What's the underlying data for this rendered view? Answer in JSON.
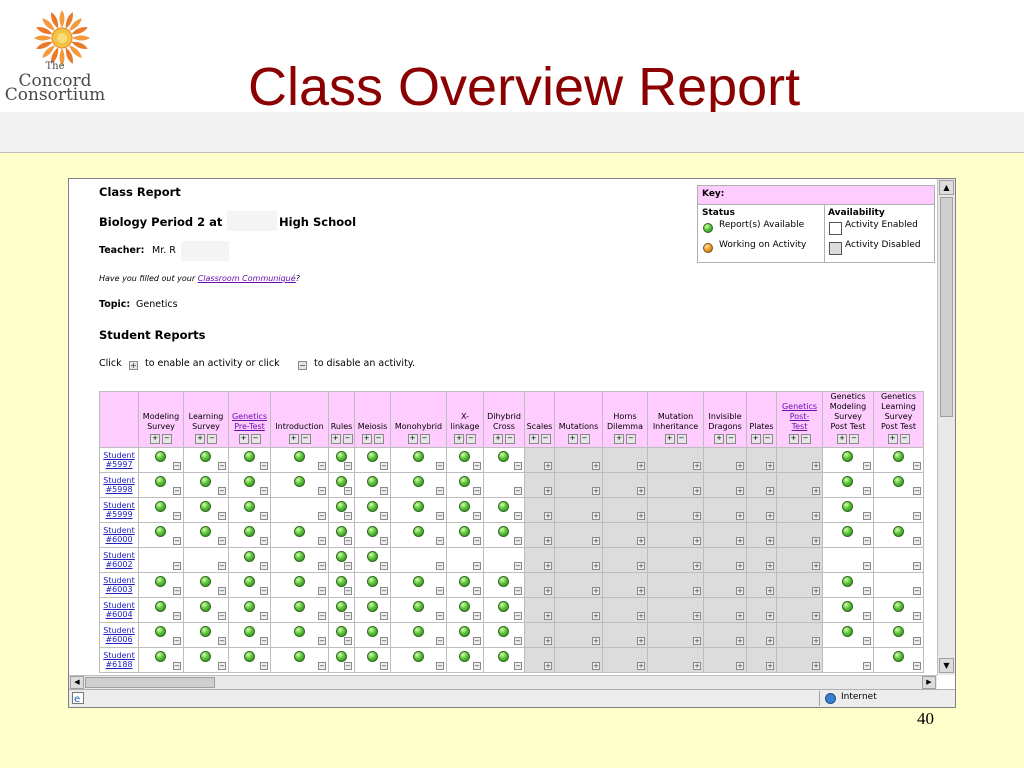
{
  "slide": {
    "title": "Class Overview Report",
    "page_number": "40",
    "logo": {
      "line1": "The",
      "line2": "Concord",
      "line3": "Consortium"
    }
  },
  "report": {
    "heading": "Class Report",
    "class_prefix": "Biology Period 2 at",
    "class_suffix": "High School",
    "teacher_label": "Teacher:",
    "teacher_value": "Mr. R",
    "communique_prefix": "Have you filled out your ",
    "communique_link": "Classroom Communiqué",
    "communique_suffix": "?",
    "topic_label": "Topic:",
    "topic_value": "Genetics",
    "student_reports": "Student Reports",
    "instruction_1": "Click",
    "instruction_2": "to enable an activity or click",
    "instruction_3": "to disable an activity."
  },
  "key": {
    "title": "Key:",
    "status_label": "Status",
    "availability_label": "Availability",
    "report_available": "Report(s) Available",
    "working": "Working on Activity",
    "enabled": "Activity Enabled",
    "disabled": "Activity Disabled"
  },
  "columns": [
    {
      "label": [
        "Modeling",
        "Survey"
      ],
      "link": false
    },
    {
      "label": [
        "Learning",
        "Survey"
      ],
      "link": false
    },
    {
      "label": [
        "Genetics",
        "Pre-Test"
      ],
      "link": true
    },
    {
      "label": [
        "Introduction"
      ],
      "link": false
    },
    {
      "label": [
        "Rules"
      ],
      "link": false
    },
    {
      "label": [
        "Meiosis"
      ],
      "link": false
    },
    {
      "label": [
        "Monohybrid"
      ],
      "link": false
    },
    {
      "label": [
        "X-",
        "linkage"
      ],
      "link": false
    },
    {
      "label": [
        "Dihybrid",
        "Cross"
      ],
      "link": false
    },
    {
      "label": [
        "Scales"
      ],
      "link": false
    },
    {
      "label": [
        "Mutations"
      ],
      "link": false
    },
    {
      "label": [
        "Horns",
        "Dilemma"
      ],
      "link": false
    },
    {
      "label": [
        "Mutation",
        "Inheritance"
      ],
      "link": false
    },
    {
      "label": [
        "Invisible",
        "Dragons"
      ],
      "link": false
    },
    {
      "label": [
        "Plates"
      ],
      "link": false
    },
    {
      "label": [
        "Genetics",
        "Post-",
        "Test"
      ],
      "link": true
    },
    {
      "label": [
        "Genetics",
        "Modeling",
        "Survey",
        "Post Test"
      ],
      "link": false
    },
    {
      "label": [
        "Genetics",
        "Learning",
        "Survey",
        "Post Test"
      ],
      "link": false
    }
  ],
  "rows": [
    {
      "student": [
        "Student",
        "#5997"
      ],
      "cells": "GGGGGGGGGdddddddGGG"
    },
    {
      "student": [
        "Student",
        "#5998"
      ],
      "cells": "GGGGGGGGedddddddGGG"
    },
    {
      "student": [
        "Student",
        "#5999"
      ],
      "cells": "GGGeGGGGGdddddddGee"
    },
    {
      "student": [
        "Student",
        "#6000"
      ],
      "cells": "GGGGGGGGGdddddddGGG"
    },
    {
      "student": [
        "Student",
        "#6002"
      ],
      "cells": "eeGGGGeeedddddddeee"
    },
    {
      "student": [
        "Student",
        "#6003"
      ],
      "cells": "GGGGGGGGGdddddddGee"
    },
    {
      "student": [
        "Student",
        "#6004"
      ],
      "cells": "GGGGGGGGGdddddddGGG"
    },
    {
      "student": [
        "Student",
        "#6006"
      ],
      "cells": "GGGGGGGGGdddddddGGG"
    },
    {
      "student": [
        "Student",
        "#6188"
      ],
      "cells": "GGGGGGGGGdddddddeGG"
    }
  ],
  "statusbar": {
    "zone": "Internet"
  },
  "colors": {
    "title": "#8b0000",
    "header_pink": "#ffccff",
    "slide_bg": "#ffffcc",
    "disabled_cell": "#dcdcdc"
  }
}
